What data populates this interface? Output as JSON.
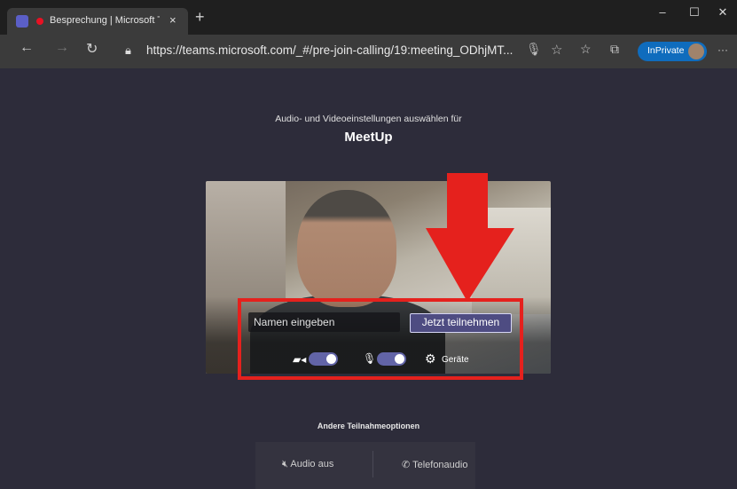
{
  "browser": {
    "tab_title": "Besprechung | Microsoft Te",
    "tab_close": "×",
    "new_tab": "+",
    "url": "https://teams.microsoft.com/_#/pre-join-calling/19:meeting_ODhjMT...",
    "inprivate_label": "InPrivate",
    "window_minimize": "–",
    "window_maximize": "☐",
    "window_close": "✕",
    "more_menu": "···"
  },
  "page": {
    "subtitle": "Audio- und Videoeinstellungen auswählen für",
    "meeting_title": "MeetUp",
    "name_placeholder": "Namen eingeben",
    "join_button": "Jetzt teilnehmen",
    "devices_label": "Geräte",
    "camera_on": true,
    "mic_on": true,
    "other_options_heading": "Andere Teilnahmeoptionen",
    "audio_off_label": "Audio aus",
    "phone_audio_label": "Telefonaudio"
  },
  "colors": {
    "accent": "#6264a7",
    "highlight": "#e5211d",
    "page_bg": "#2d2c3a"
  }
}
